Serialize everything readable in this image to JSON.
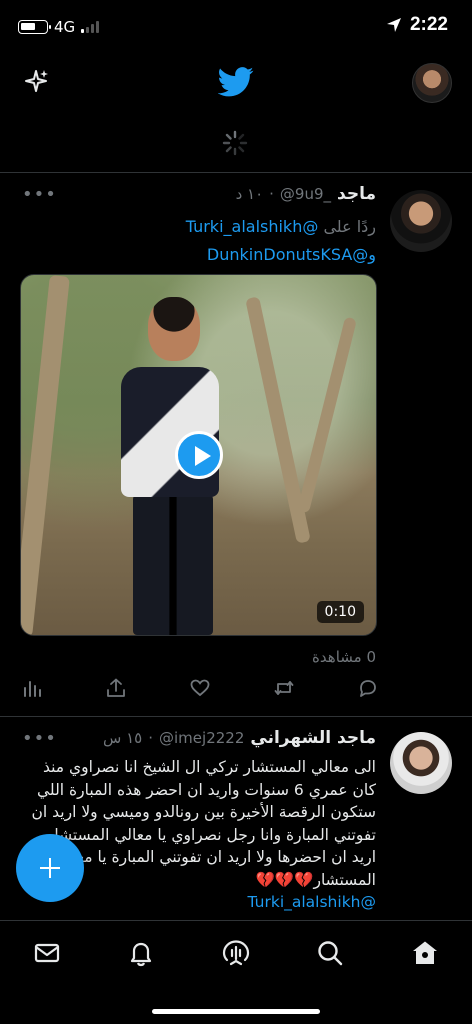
{
  "status_bar": {
    "carrier": "4G",
    "time": "2:22"
  },
  "tweet1": {
    "name": "ماجد",
    "handle": "@9u9_",
    "time": "١٠ د",
    "replying_to_prefix": "ردًا على",
    "mention1": "@Turki_alalshikh",
    "mention2_prefix": "و",
    "mention2": "@DunkinDonutsKSA",
    "video_duration": "0:10",
    "views": "0 مشاهدة"
  },
  "tweet2": {
    "name": "ماجد الشهراني",
    "handle": "@imej2222",
    "time": "١٥ س",
    "text": "الى معالي المستشار تركي ال الشيخ انا نصراوي منذ كان عمري 6 سنوات واريد ان احضر هذه المبارة اللي ستكون الرقصة الأخيرة بين رونالدو وميسي ولا اريد ان تفوتني المبارة وانا رجل نصراوي يا معالي المستشار اريد ان احضرها ولا اريد ان تفوتني المبارة يا معالي المستشار💔💔💔",
    "mention": "@Turki_alalshikh"
  },
  "icons": {
    "top_left": "sparkle-icon",
    "top_center": "twitter-bird-icon",
    "bottom_nav": [
      "mail-icon",
      "bell-icon",
      "spaces-icon",
      "search-icon",
      "home-icon"
    ],
    "actions": [
      "analytics-icon",
      "share-icon",
      "like-icon",
      "retweet-icon",
      "reply-icon"
    ]
  },
  "colors": {
    "accent": "#1d9bf0",
    "background": "#000000",
    "muted": "#71767b"
  }
}
